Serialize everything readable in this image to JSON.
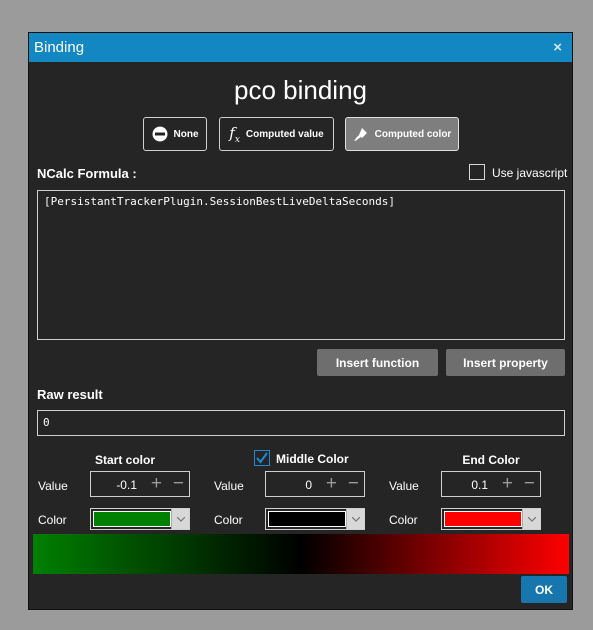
{
  "window": {
    "title": "Binding",
    "close_symbol": "×"
  },
  "heading": "pco binding",
  "modes": [
    {
      "label": "None",
      "icon": "no-entry-icon",
      "active": false
    },
    {
      "label": "Computed value",
      "icon": "function-icon",
      "active": false
    },
    {
      "label": "Computed color",
      "icon": "paint-brush-icon",
      "active": true
    }
  ],
  "formula": {
    "label": "NCalc Formula :",
    "use_javascript_label": "Use javascript",
    "use_javascript_checked": false,
    "value": "[PersistantTrackerPlugin.SessionBestLiveDeltaSeconds]"
  },
  "buttons": {
    "insert_function": "Insert function",
    "insert_property": "Insert property",
    "ok": "OK"
  },
  "raw_result": {
    "label": "Raw result",
    "value": "0"
  },
  "colors": {
    "start": {
      "title": "Start color",
      "value_label": "Value",
      "value": "-0.1",
      "color_label": "Color",
      "color": "#008000"
    },
    "middle": {
      "title": "Middle Color",
      "enabled": true,
      "value_label": "Value",
      "value": "0",
      "color_label": "Color",
      "color": "#000000"
    },
    "end": {
      "title": "End Color",
      "value_label": "Value",
      "value": "0.1",
      "color_label": "Color",
      "color": "#ff0000"
    }
  },
  "accent": "#1287c2"
}
